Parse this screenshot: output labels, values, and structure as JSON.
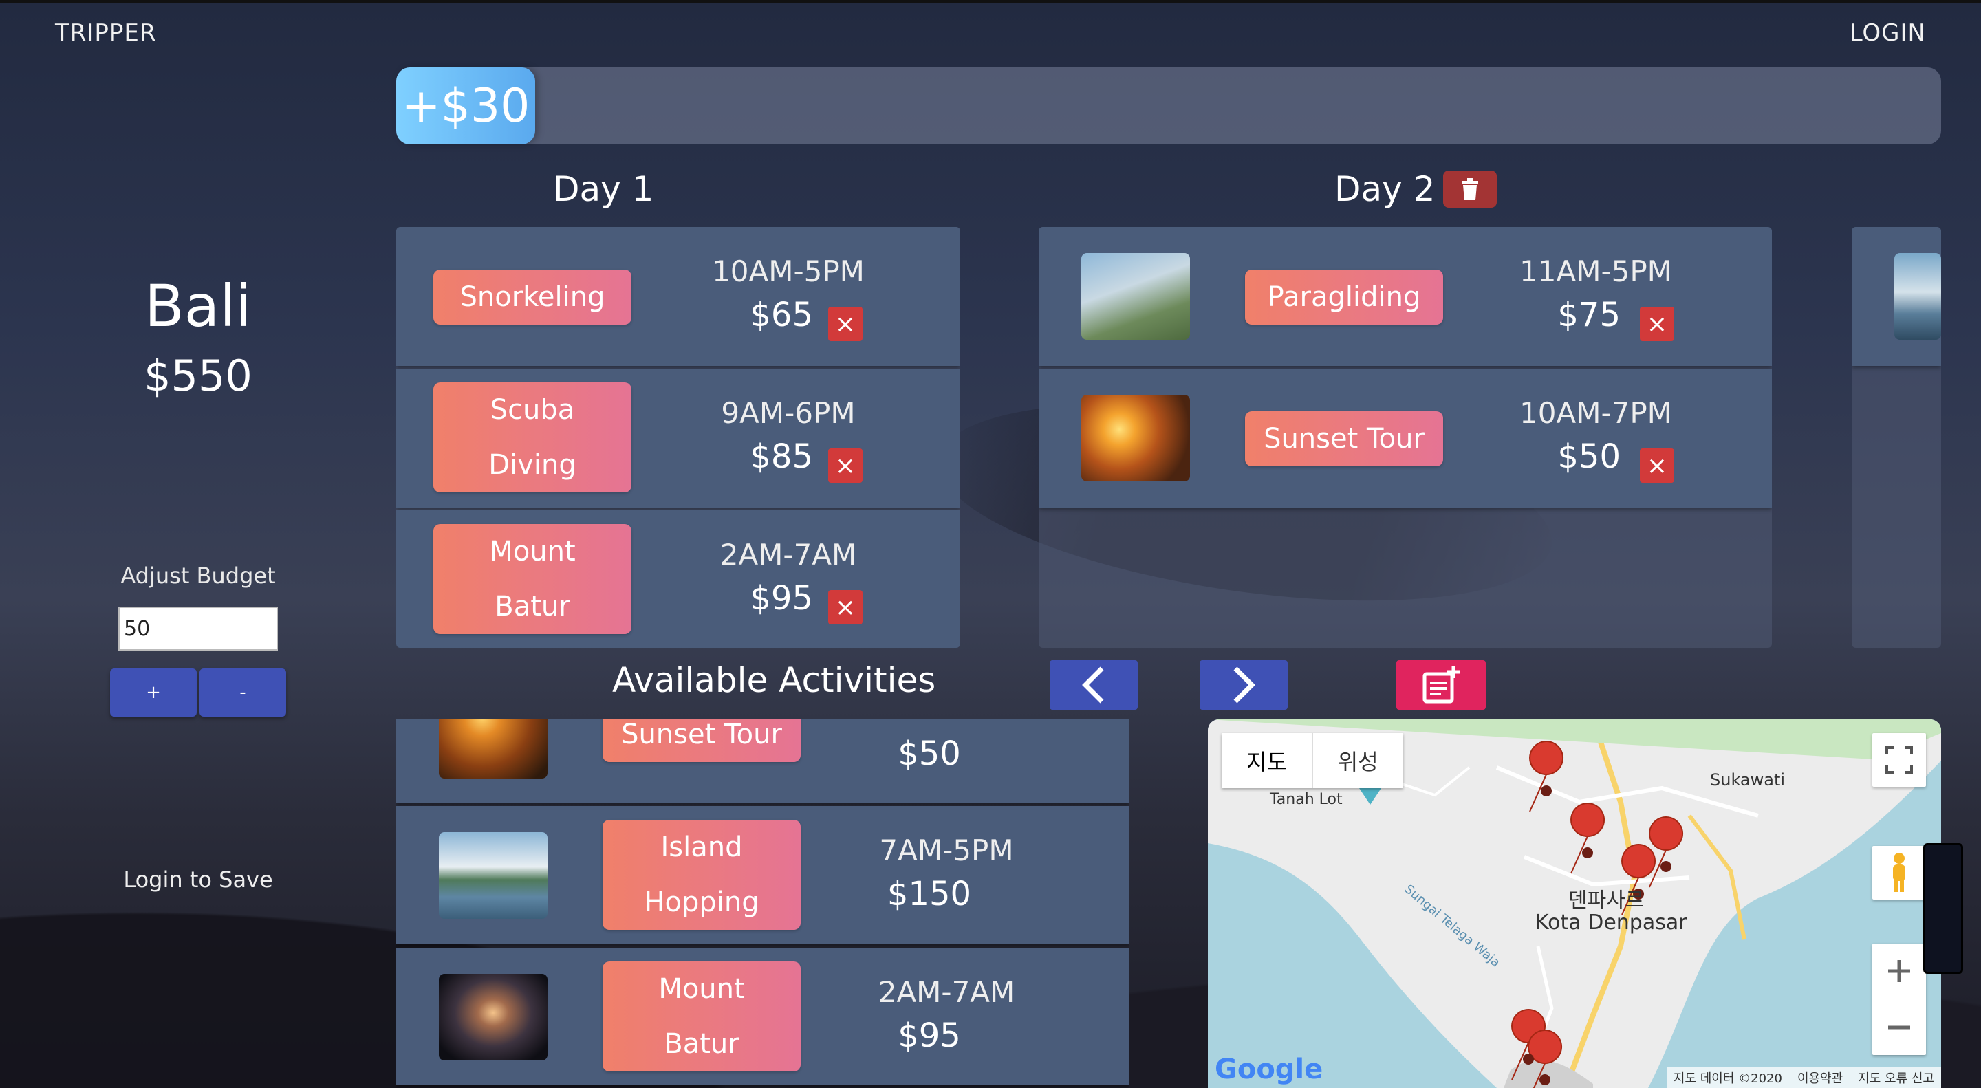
{
  "app": {
    "brand": "TRIPPER",
    "login_label": "LOGIN"
  },
  "budget": {
    "remaining_label": "+$30",
    "fill_fraction": 0.09
  },
  "destination": {
    "name": "Bali",
    "price": "$550"
  },
  "adjust": {
    "label": "Adjust Budget",
    "input_value": "50",
    "plus_label": "+",
    "minus_label": "-"
  },
  "login_to_save": "Login to Save",
  "days": [
    {
      "title": "Day 1",
      "activities": [
        {
          "name": "Snorkeling",
          "time": "10AM-5PM",
          "price": "$65"
        },
        {
          "name_line1": "Scuba",
          "name_line2": "Diving",
          "time": "9AM-6PM",
          "price": "$85"
        },
        {
          "name_line1": "Mount",
          "name_line2": "Batur",
          "time": "2AM-7AM",
          "price": "$95"
        }
      ]
    },
    {
      "title": "Day 2",
      "activities": [
        {
          "name": "Paragliding",
          "time": "11AM-5PM",
          "price": "$75"
        },
        {
          "name": "Sunset Tour",
          "time": "10AM-7PM",
          "price": "$50"
        }
      ]
    }
  ],
  "available": {
    "title": "Available Activities",
    "items": [
      {
        "name": "Sunset Tour",
        "price": "$50"
      },
      {
        "name_line1": "Island",
        "name_line2": "Hopping",
        "time": "7AM-5PM",
        "price": "$150"
      },
      {
        "name_line1": "Mount",
        "name_line2": "Batur",
        "time": "2AM-7AM",
        "price": "$95"
      }
    ]
  },
  "map": {
    "tab_map": "지도",
    "tab_satellite": "위성",
    "place_tanah_lot": "Tanah Lot",
    "place_sukawati": "Sukawati",
    "place_denpasar_kr": "덴파사르",
    "place_denpasar": "Kota Denpasar",
    "river_label": "Sungai Telaga Waja",
    "copyright": "지도 데이터 ©2020",
    "terms": "이용약관",
    "report": "지도 오류 신고",
    "google": "Google"
  },
  "icons": {
    "remove": "×"
  },
  "colors": {
    "accent_blue": "#3f51b5",
    "pill_start": "#f0806a",
    "pill_end": "#e57494",
    "remove_red": "#d23a3a",
    "add_pink": "#e0245e",
    "trash_red": "#a33434"
  }
}
